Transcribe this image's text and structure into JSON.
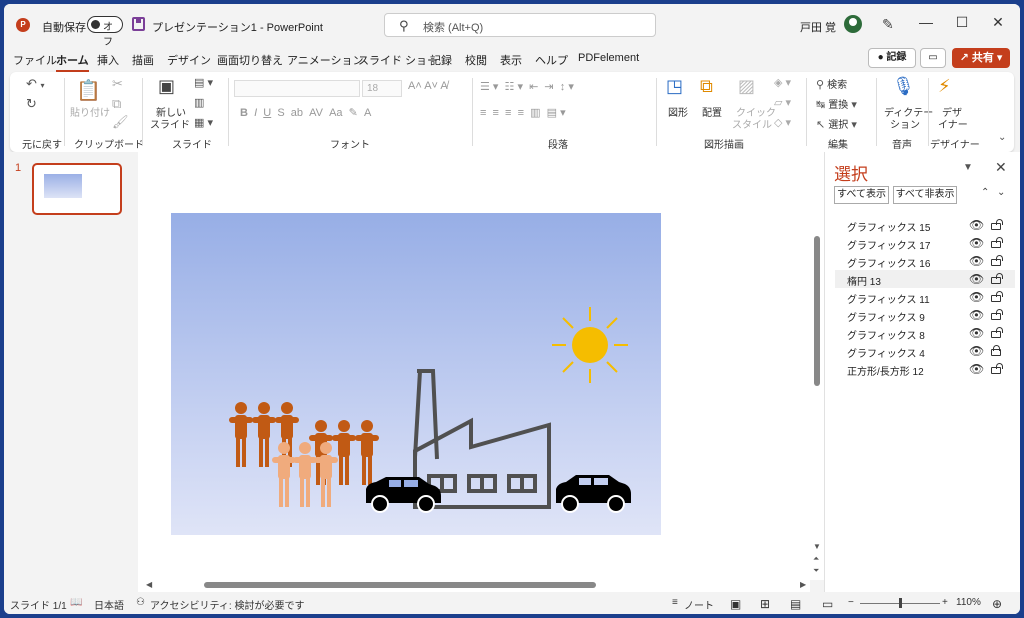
{
  "titlebar": {
    "autosave_label": "自動保存",
    "autosave_state": "オフ",
    "doc_title": "プレゼンテーション1  -  PowerPoint",
    "search_placeholder": "検索 (Alt+Q)",
    "user_name": "戸田 覚"
  },
  "menu": {
    "items": [
      "ファイル",
      "ホーム",
      "挿入",
      "描画",
      "デザイン",
      "画面切り替え",
      "アニメーション",
      "スライド ショー",
      "記録",
      "校閲",
      "表示",
      "ヘルプ",
      "PDFelement"
    ],
    "record_label": "記録",
    "share_label": "共有"
  },
  "ribbon": {
    "groups": {
      "undo": "元に戻す",
      "clipboard": "クリップボード",
      "slides": "スライド",
      "font": "フォント",
      "paragraph": "段落",
      "drawing": "図形描画",
      "editing": "編集",
      "voice": "音声",
      "designer": "デザイナー"
    },
    "paste_label": "貼り付け",
    "new_slide_label1": "新しい",
    "new_slide_label2": "スライド",
    "font_size": "18",
    "shapes_label": "図形",
    "arrange_label": "配置",
    "quick_style_label1": "クイック",
    "quick_style_label2": "スタイル",
    "find_label": "検索",
    "replace_label": "置換",
    "select_label": "選択",
    "dictate_label1": "ディクテー",
    "dictate_label2": "ション",
    "designer_label1": "デザ",
    "designer_label2": "イナー"
  },
  "thumbnails": {
    "slide_number": "1"
  },
  "selection_pane": {
    "title": "選択",
    "show_all": "すべて表示",
    "hide_all": "すべて非表示",
    "layers": [
      {
        "name": "グラフィックス 15",
        "locked": false
      },
      {
        "name": "グラフィックス 17",
        "locked": false
      },
      {
        "name": "グラフィックス 16",
        "locked": false
      },
      {
        "name": "楕円 13",
        "locked": false
      },
      {
        "name": "グラフィックス 11",
        "locked": false
      },
      {
        "name": "グラフィックス 9",
        "locked": false
      },
      {
        "name": "グラフィックス 8",
        "locked": false
      },
      {
        "name": "グラフィックス 4",
        "locked": true
      },
      {
        "name": "正方形/長方形 12",
        "locked": false
      }
    ]
  },
  "status": {
    "slide_info": "スライド 1/1",
    "language": "日本語",
    "accessibility": "アクセシビリティ: 検討が必要です",
    "notes_label": "ノート",
    "zoom": "110%"
  },
  "colors": {
    "accent": "#c43e1c",
    "sun": "#f5bd00",
    "people_dark": "#c15a14",
    "people_light": "#f0ab7d",
    "factory": "#505050"
  }
}
